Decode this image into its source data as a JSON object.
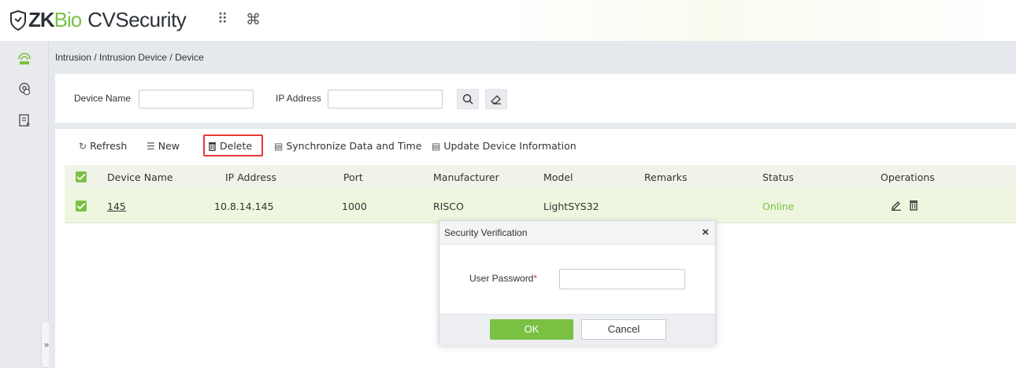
{
  "app": {
    "logo_zk": "ZK",
    "logo_bio": "Bio",
    "logo_cv": "CVSecurity",
    "grid_icon": "⠿",
    "cmd_icon": "⌘"
  },
  "breadcrumb": "Intrusion / Intrusion Device / Device",
  "search": {
    "device_name_label": "Device Name",
    "device_name_value": "",
    "ip_address_label": "IP Address",
    "ip_address_value": ""
  },
  "toolbar": {
    "refresh": "Refresh",
    "new": "New",
    "delete": "Delete",
    "sync": "Synchronize Data and Time",
    "update": "Update Device Information"
  },
  "table": {
    "headers": [
      "Device Name",
      "IP Address",
      "Port",
      "Manufacturer",
      "Model",
      "Remarks",
      "Status",
      "Operations"
    ],
    "rows": [
      {
        "device_name": "145",
        "ip_address": "10.8.14.145",
        "port": "1000",
        "manufacturer": "RISCO",
        "model": "LightSYS32",
        "remarks": "",
        "status": "Online"
      }
    ]
  },
  "modal": {
    "title": "Security Verification",
    "close": "×",
    "password_label": "User Password",
    "required_mark": "*",
    "password_value": "",
    "ok": "OK",
    "cancel": "Cancel"
  },
  "colors": {
    "accent": "#7ac143",
    "highlight": "#e53935"
  },
  "icons": [
    "shield-logo-icon",
    "grid-icon",
    "command-icon",
    "intrusion-module-icon",
    "monitor-module-icon",
    "report-module-icon",
    "search-icon",
    "eraser-icon",
    "refresh-icon",
    "new-icon",
    "trash-icon",
    "sync-icon",
    "update-icon",
    "edit-icon",
    "close-icon",
    "expand-icon"
  ]
}
